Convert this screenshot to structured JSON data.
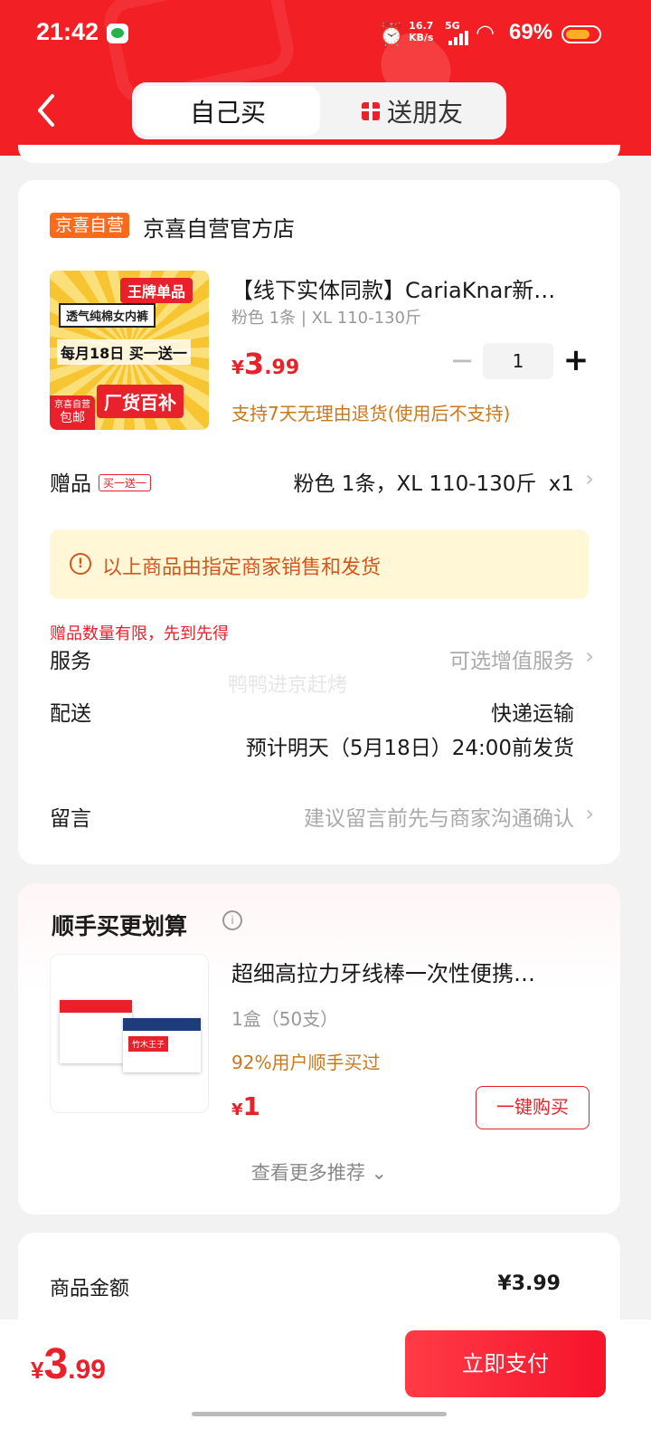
{
  "status_bar": {
    "time": "21:42",
    "net_speed_value": "16.7",
    "net_speed_unit": "KB/s",
    "network": "5G",
    "battery": "69%"
  },
  "header": {
    "tabs": [
      {
        "label": "自己买",
        "active": true
      },
      {
        "label": "送朋友",
        "active": false
      }
    ]
  },
  "shop": {
    "badge": "京喜自营",
    "name": "京喜自营官方店"
  },
  "product": {
    "thumb_texts": {
      "banner": "王牌单品",
      "subtitle": "透气纯棉女内裤",
      "promo": "每月18日 买一送一",
      "subsidy": "厂货百补",
      "corner_line1": "京喜自营",
      "corner_line2": "包邮"
    },
    "title": "【线下实体同款】CariaKnar新疆…",
    "spec": "粉色 1条 | XL 110-130斤",
    "price_symbol": "¥",
    "price_int": "3",
    "price_dec": ".99",
    "quantity": "1",
    "return_policy": "支持7天无理由退货(使用后不支持)"
  },
  "gift_row": {
    "label": "赠品",
    "tag": "买一送一",
    "value": "粉色 1条，XL 110-130斤",
    "count": "x1"
  },
  "notice": "以上商品由指定商家销售和发货",
  "limit_text": "赠品数量有限，先到先得",
  "watermark": "鸭鸭进京赶烤",
  "service": {
    "label": "服务",
    "value": "可选增值服务"
  },
  "delivery": {
    "label": "配送",
    "method": "快递运输",
    "estimate": "预计明天（5月18日）24:00前发货"
  },
  "message": {
    "label": "留言",
    "placeholder": "建议留言前先与商家沟通确认"
  },
  "recommend": {
    "title": "顺手买更划算",
    "item": {
      "name": "超细高拉力牙线棒一次性便携…",
      "spec": "1盒（50支）",
      "stat": "92%用户顺手买过",
      "price_symbol": "¥",
      "price": "1",
      "buy_label": "一键购买",
      "thumb_label": "竹木王子"
    },
    "more": "查看更多推荐"
  },
  "summary": {
    "label": "商品金额",
    "value": "¥3.99"
  },
  "bottom": {
    "total_symbol": "¥",
    "total_int": "3",
    "total_dec": ".99",
    "pay_label": "立即支付"
  },
  "colors": {
    "brand_red": "#f21f24",
    "accent_orange": "#ff6a1a",
    "notice_bg": "#fff7d6",
    "notice_text": "#d2561e"
  }
}
